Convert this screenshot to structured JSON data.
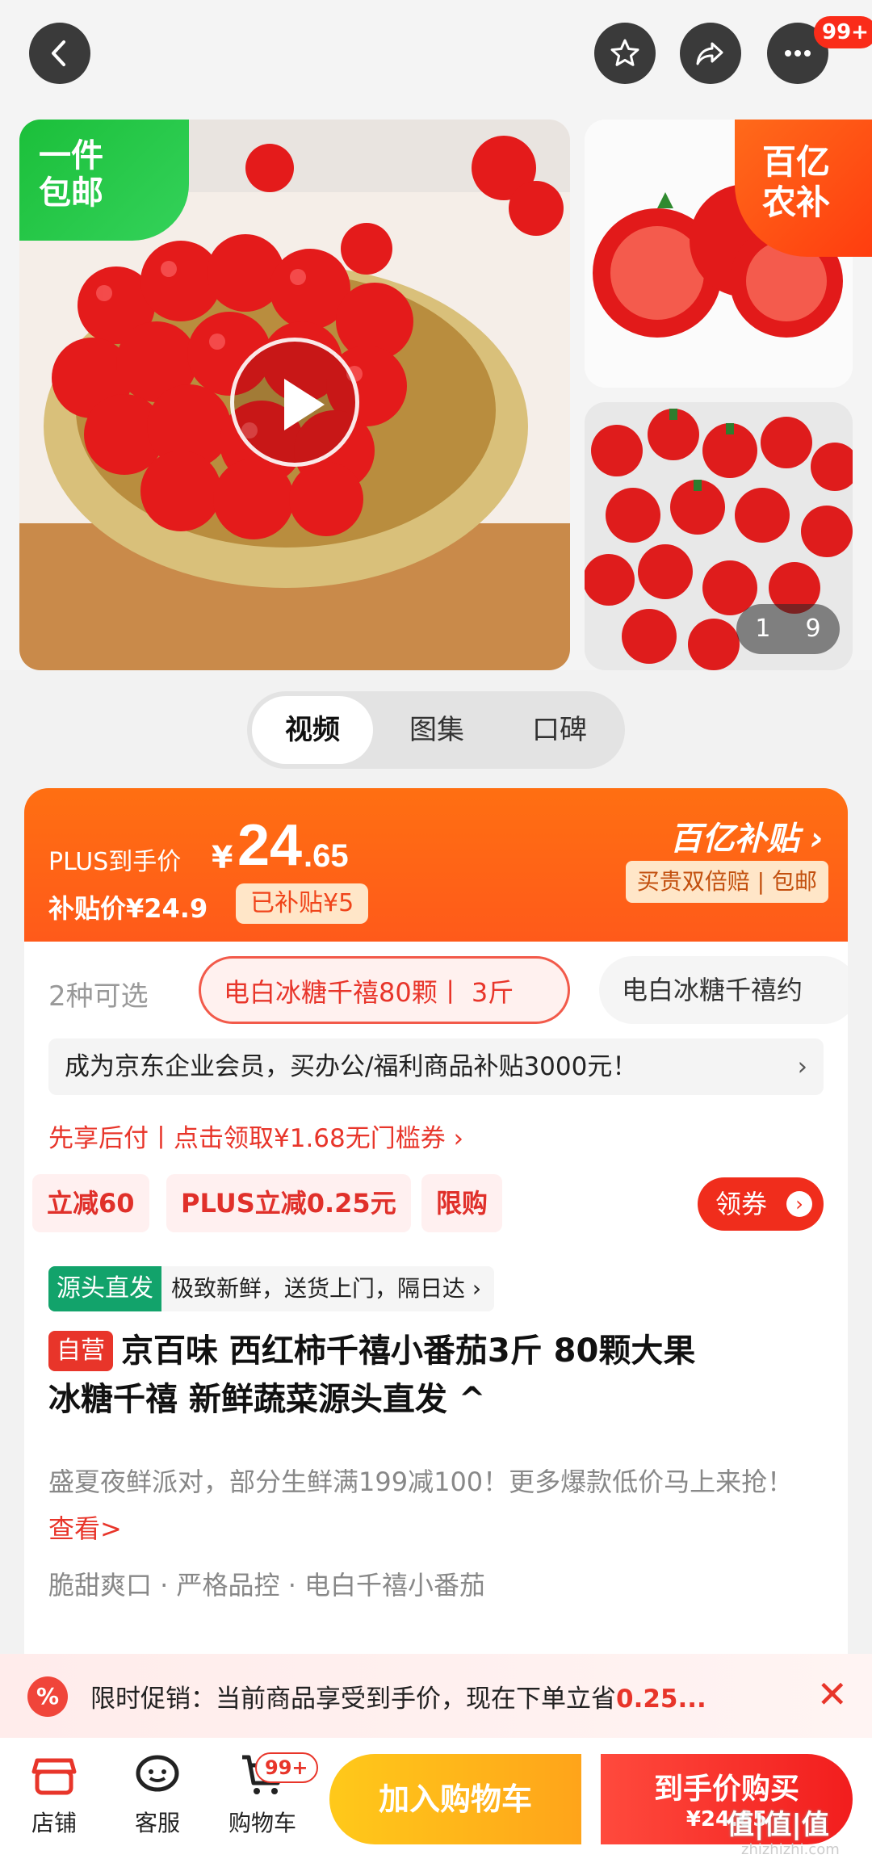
{
  "gallery": {
    "free_ship_badge": "一件\n包邮",
    "yi_badge": "百亿\n农补",
    "counter_current": "1",
    "counter_total": "9",
    "notification_count": "99+"
  },
  "media_tabs": [
    {
      "label": "视频"
    },
    {
      "label": "图集"
    },
    {
      "label": "口碑"
    }
  ],
  "price": {
    "plus_label": "PLUS到手价",
    "currency": "¥",
    "integer": "24",
    "decimal": ".65",
    "subsidy_price": "补贴价¥24.9",
    "subsidized": "已补贴¥5",
    "yi_subsidy_title": "百亿补贴 ›",
    "yi_subsidy_sub": "买贵双倍赔 | 包邮"
  },
  "specs": {
    "count": "2种可选",
    "selected": "电白冰糖千禧80颗丨 3斤",
    "other": "电白冰糖千禧约"
  },
  "enterprise_banner": "成为京东企业会员，买办公/福利商品补贴3000元！",
  "pay_later": "先享后付丨点击领取¥1.68无门槛券 ›",
  "promo_chips": [
    "立减60",
    "PLUS立减0.25元",
    "限购"
  ],
  "coupon_button": "领券",
  "source": {
    "tag": "源头直发",
    "text": "极致新鲜，送货上门，隔日达 ›"
  },
  "product": {
    "self_tag": "自营",
    "title_line1": "京百味 西红柿千禧小番茄3斤 80颗大果",
    "title_line2": "冰糖千禧 新鲜蔬菜源头直发 ^",
    "desc": "盛夏夜鲜派对，部分生鲜满199减100！更多爆款低价马上来抢！",
    "look": "查看>",
    "features": "脆甜爽口 · 严格品控 · 电白千禧小番茄"
  },
  "promo_bar": {
    "icon": "%",
    "text": "限时促销：当前商品享受到手价，现在下单立省",
    "amount": "0.25...",
    "close": "✕"
  },
  "bottom_nav": [
    {
      "label": "店铺"
    },
    {
      "label": "客服"
    },
    {
      "label": "购物车"
    }
  ],
  "cart_badge": "99+",
  "add_cart": "加入购物车",
  "buy": {
    "label": "到手价购买",
    "price": "¥24.65"
  },
  "watermark": "值|值|值",
  "watermark_sub": "zhizhizhi.com",
  "colors": {
    "accent_orange": "#ff6f12",
    "accent_red": "#e8352a",
    "add_cart_yellow": "#ffb81a",
    "green_tag": "#12a36b"
  }
}
